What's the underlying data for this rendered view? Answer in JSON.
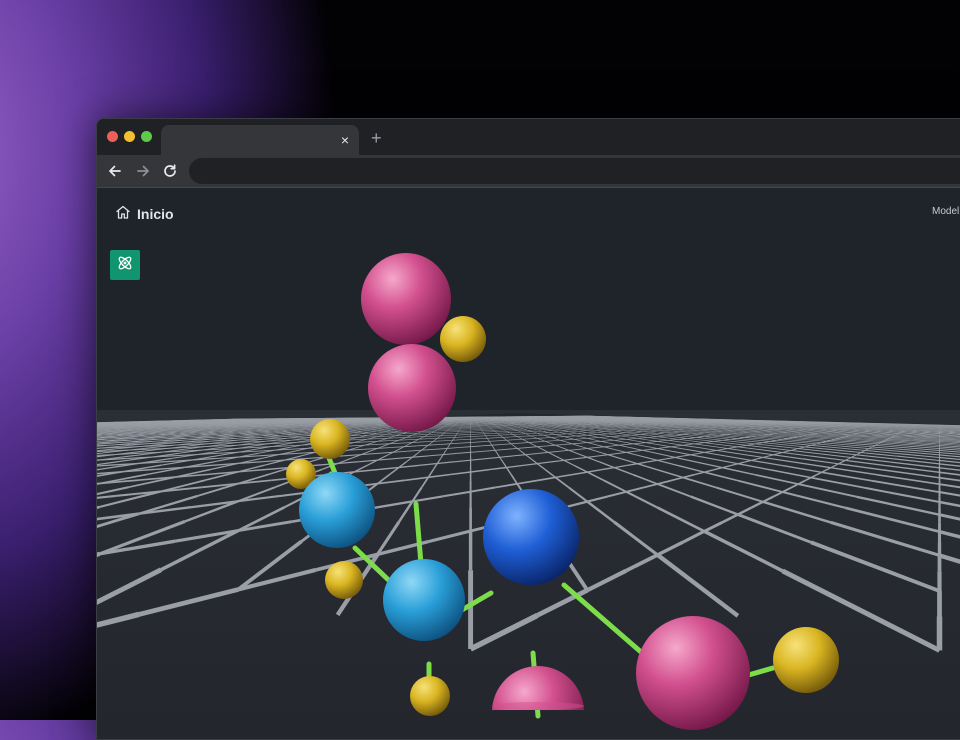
{
  "browser": {
    "tab": {
      "title": "",
      "close_glyph": "×"
    },
    "new_tab_glyph": "+",
    "address": {
      "url": ""
    },
    "icons": {
      "back": "arrow-left-icon",
      "forward": "arrow-right-icon",
      "reload": "reload-icon",
      "close": "close-icon"
    },
    "traffic_lights": {
      "close": "#ee5f57",
      "minimize": "#f5bd30",
      "maximize": "#5ec848"
    }
  },
  "header": {
    "home_label": "Inicio",
    "home_icon": "home-icon",
    "model_label": "Model"
  },
  "sidebar": {
    "app_icon": "atom-icon",
    "app_icon_color": "#10956e"
  },
  "molecule": {
    "bond_color": "#7ddc4a",
    "atom_colors": {
      "magenta": "#d2508e",
      "yellow": "#d9b521",
      "cyan": "#2a9fd8",
      "blue": "#1f5fd6"
    }
  }
}
